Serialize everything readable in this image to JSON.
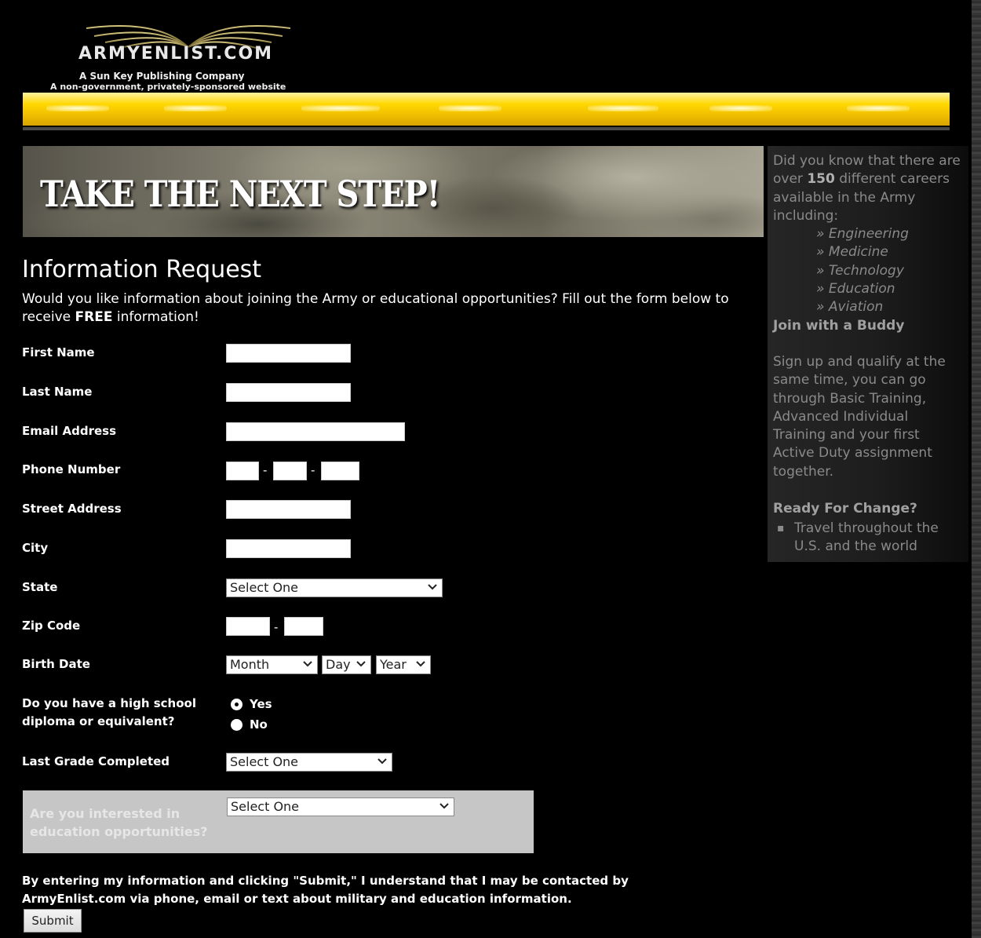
{
  "header": {
    "logo_text": "ARMYENLIST.COM",
    "logo_sub1": "A Sun Key Publishing Company",
    "logo_sub2": "A non-government, privately-sponsored website"
  },
  "banner": {
    "title": "TAKE THE NEXT STEP!"
  },
  "form": {
    "title": "Information Request",
    "intro_pre": "Would you like information about joining the Army or educational opportunities? Fill out the form below to receive ",
    "intro_bold": "FREE",
    "intro_post": " information!",
    "labels": {
      "first_name": "First Name",
      "last_name": "Last Name",
      "email": "Email Address",
      "phone": "Phone Number",
      "street": "Street Address",
      "city": "City",
      "state": "State",
      "zip": "Zip Code",
      "birth_date": "Birth Date",
      "diploma": "Do you have a high school diploma or equivalent?",
      "last_grade": "Last Grade Completed",
      "education": "Are you interested in education opportunities?"
    },
    "values": {
      "first_name": "",
      "last_name": "",
      "email": "",
      "phone_area": "",
      "phone_prefix": "",
      "phone_line": "",
      "street": "",
      "city": "",
      "zip5": "",
      "zip4": ""
    },
    "phone_separator": "-",
    "zip_separator": "-",
    "selects": {
      "state": "Select One",
      "birth_month": "Month",
      "birth_day": "Day",
      "birth_year": "Year",
      "last_grade": "Select One",
      "education": "Select One"
    },
    "diploma_options": [
      {
        "label": "Yes",
        "checked": true
      },
      {
        "label": "No",
        "checked": false
      }
    ],
    "disclaimer": "By entering my information and clicking \"Submit,\" I understand that I may be contacted by ArmyEnlist.com via phone, email or text about military and education information.",
    "submit_label": "Submit"
  },
  "sidebar": {
    "fact_pre": "Did you know that there are over ",
    "fact_number": "150",
    "fact_post": " different careers available in the Army including:",
    "careers": [
      "» Engineering",
      "» Medicine",
      "» Technology",
      "» Education",
      "» Aviation"
    ],
    "buddy_heading": "Join with a Buddy",
    "buddy_text": "Sign up and qualify at the same time, you can go through Basic Training, Advanced Individual Training and your first Active Duty assignment together.",
    "change_heading": "Ready For Change?",
    "change_items": [
      "Travel throughout the U.S. and the world"
    ],
    "bullet_glyph": "▪"
  },
  "colors": {
    "background": "#000000",
    "navbar_yellow": "#ffd700",
    "sidebar_text": "#8a8a8a",
    "edu_box": "#c6c6c6"
  }
}
